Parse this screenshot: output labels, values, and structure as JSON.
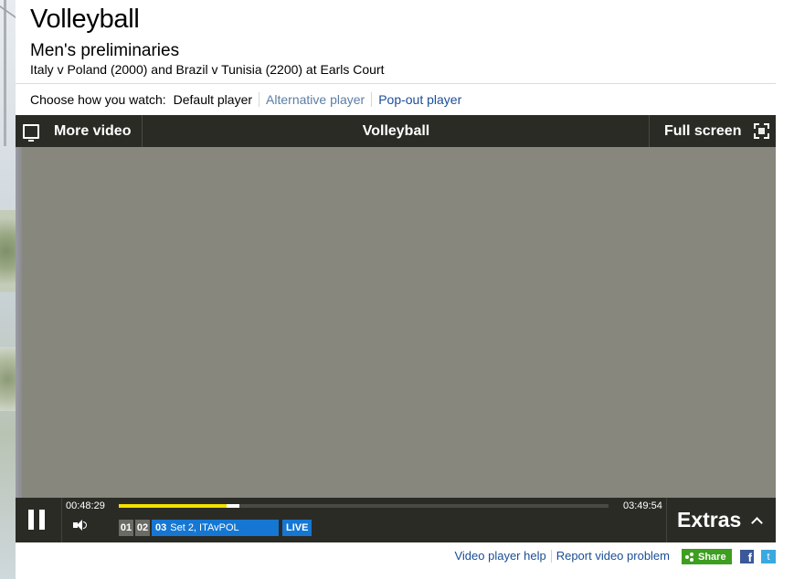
{
  "header": {
    "title": "Volleyball",
    "subtitle": "Men's preliminaries",
    "description": "Italy v Poland (2000) and Brazil v Tunisia (2200) at Earls Court"
  },
  "watch": {
    "label": "Choose how you watch:",
    "options": [
      {
        "label": "Default player",
        "active": true
      },
      {
        "label": "Alternative player",
        "active": false
      },
      {
        "label": "Pop-out player",
        "active": false
      }
    ]
  },
  "player": {
    "more_video_label": "More video",
    "title": "Volleyball",
    "full_screen_label": "Full screen",
    "current_time": "00:48:29",
    "end_time": "03:49:54",
    "progress_fraction": 0.22,
    "buffer_fraction": 0.22,
    "chapters": [
      {
        "num": "01",
        "name": ""
      },
      {
        "num": "02",
        "name": ""
      },
      {
        "num": "03",
        "name": "Set 2, ITAvPOL"
      }
    ],
    "live_label": "LIVE",
    "extras_label": "Extras"
  },
  "footer": {
    "help_label": "Video player help",
    "report_label": "Report video problem",
    "share_label": "Share",
    "facebook_glyph": "f",
    "twitter_glyph": "t"
  },
  "colors": {
    "player_bg": "#2b2b26",
    "video_bg": "#87877d",
    "progress": "#f2e100",
    "chapter_active": "#1577d2",
    "share_green": "#3d9e1f",
    "link_blue": "#1a4d96"
  }
}
